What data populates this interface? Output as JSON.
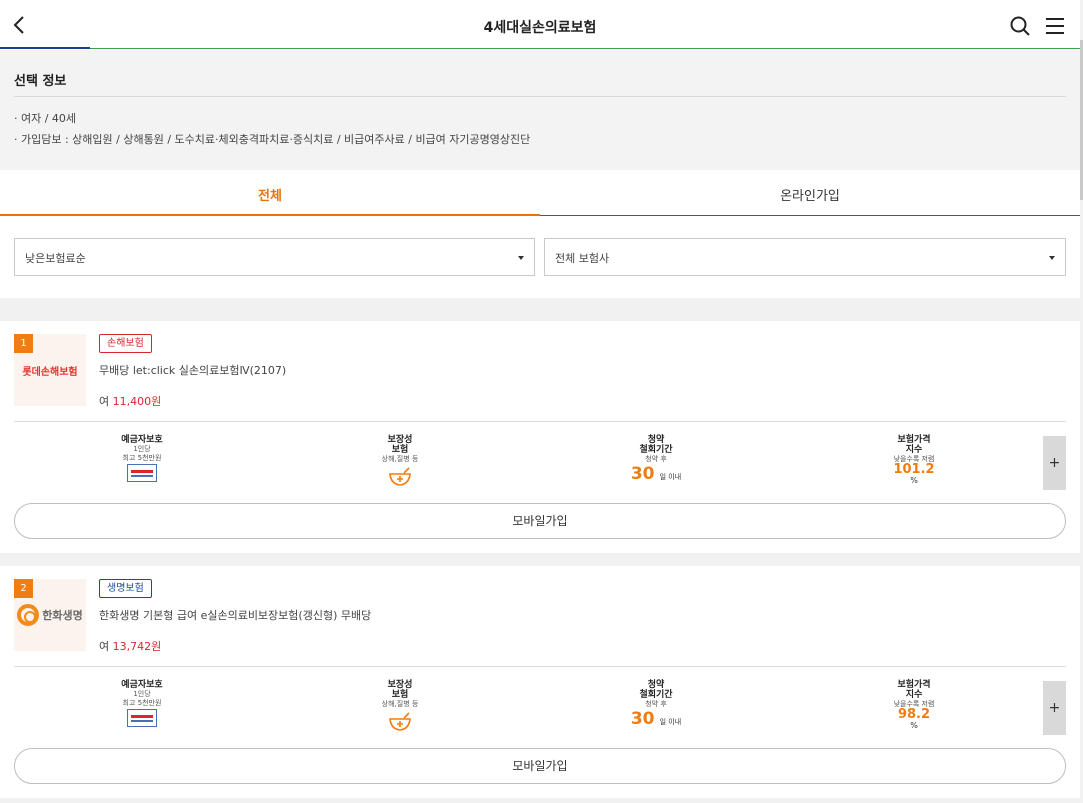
{
  "header": {
    "title": "4세대실손의료보험",
    "icons": {
      "back": "back-arrow-icon",
      "search": "search-icon",
      "menu": "hamburger-menu-icon"
    },
    "accent_colors": {
      "blue": "#1a3f8c",
      "green": "#3aa04a"
    }
  },
  "selection_info": {
    "heading": "선택 정보",
    "line1": "· 여자 / 40세",
    "line2": "· 가입담보 : 상해입원 / 상해통원 / 도수치료·체외충격파치료·증식치료 / 비급여주사료 / 비급여 자기공명영상진단"
  },
  "tabs": [
    {
      "label": "전체",
      "active": true
    },
    {
      "label": "온라인가입",
      "active": false
    }
  ],
  "filters": {
    "sort": "낮은보험료순",
    "company": "전체 보험사"
  },
  "colors": {
    "accent": "#ef7d12",
    "price": "#d9262c"
  },
  "products": [
    {
      "rank": "1",
      "logo_text": "롯데손해보험",
      "category": "손해보험",
      "name": "무배당 let:click 실손의료보험Ⅳ(2107)",
      "gender": "여",
      "price": "11,400원",
      "features": {
        "deposit": {
          "title": "예금자보호",
          "sub1": "1인당",
          "sub2": "최고 5천만원"
        },
        "coverage": {
          "title1": "보장성",
          "title2": "보험",
          "sub": "상해,질병 등"
        },
        "withdraw": {
          "title1": "청약",
          "title2": "철회기간",
          "sub": "청약 후",
          "days": "30",
          "days_label": "일 이내"
        },
        "price_index": {
          "title1": "보험가격",
          "title2": "지수",
          "sub": "낮을수록 저렴",
          "value": "101.2",
          "unit": "%"
        }
      },
      "more": "+",
      "cta": "모바일가입"
    },
    {
      "rank": "2",
      "logo_text": "한화생명",
      "category": "생명보험",
      "name": "한화생명 기본형 급여 e실손의료비보장보험(갱신형) 무배당",
      "gender": "여",
      "price": "13,742원",
      "features": {
        "deposit": {
          "title": "예금자보호",
          "sub1": "1인당",
          "sub2": "최고 5천만원"
        },
        "coverage": {
          "title1": "보장성",
          "title2": "보험",
          "sub": "상해,질병 등"
        },
        "withdraw": {
          "title1": "청약",
          "title2": "철회기간",
          "sub": "청약 후",
          "days": "30",
          "days_label": "일 이내"
        },
        "price_index": {
          "title1": "보험가격",
          "title2": "지수",
          "sub": "낮을수록 저렴",
          "value": "98.2",
          "unit": "%"
        }
      },
      "more": "+",
      "cta": "모바일가입"
    }
  ]
}
